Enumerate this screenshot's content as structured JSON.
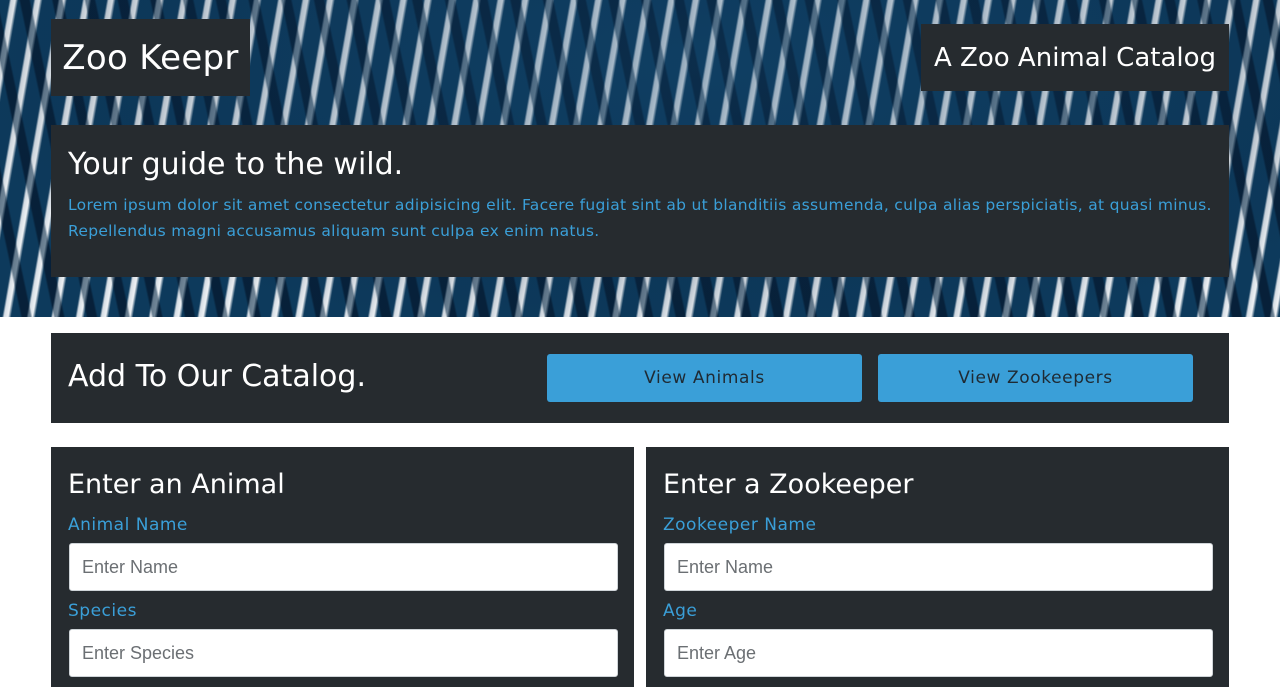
{
  "header": {
    "brand": "Zoo Keepr",
    "tagline": "A Zoo Animal Catalog"
  },
  "intro": {
    "heading": "Your guide to the wild.",
    "body": "Lorem ipsum dolor sit amet consectetur adipisicing elit. Facere fugiat sint ab ut blanditiis assumenda, culpa alias perspiciatis, at quasi minus. Repellendus magni accusamus aliquam sunt culpa ex enim natus."
  },
  "catalog": {
    "heading": "Add To Our Catalog.",
    "view_animals_label": "View Animals",
    "view_zookeepers_label": "View Zookeepers"
  },
  "animal_form": {
    "heading": "Enter an Animal",
    "name_label": "Animal Name",
    "name_placeholder": "Enter Name",
    "species_label": "Species",
    "species_placeholder": "Enter Species"
  },
  "zookeeper_form": {
    "heading": "Enter a Zookeeper",
    "name_label": "Zookeeper Name",
    "name_placeholder": "Enter Name",
    "age_label": "Age",
    "age_placeholder": "Enter Age"
  },
  "colors": {
    "panel_bg": "#262b2f",
    "accent": "#3a9fd8",
    "hero_dark": "#0d3a5c",
    "hero_light": "#eef1f4"
  }
}
